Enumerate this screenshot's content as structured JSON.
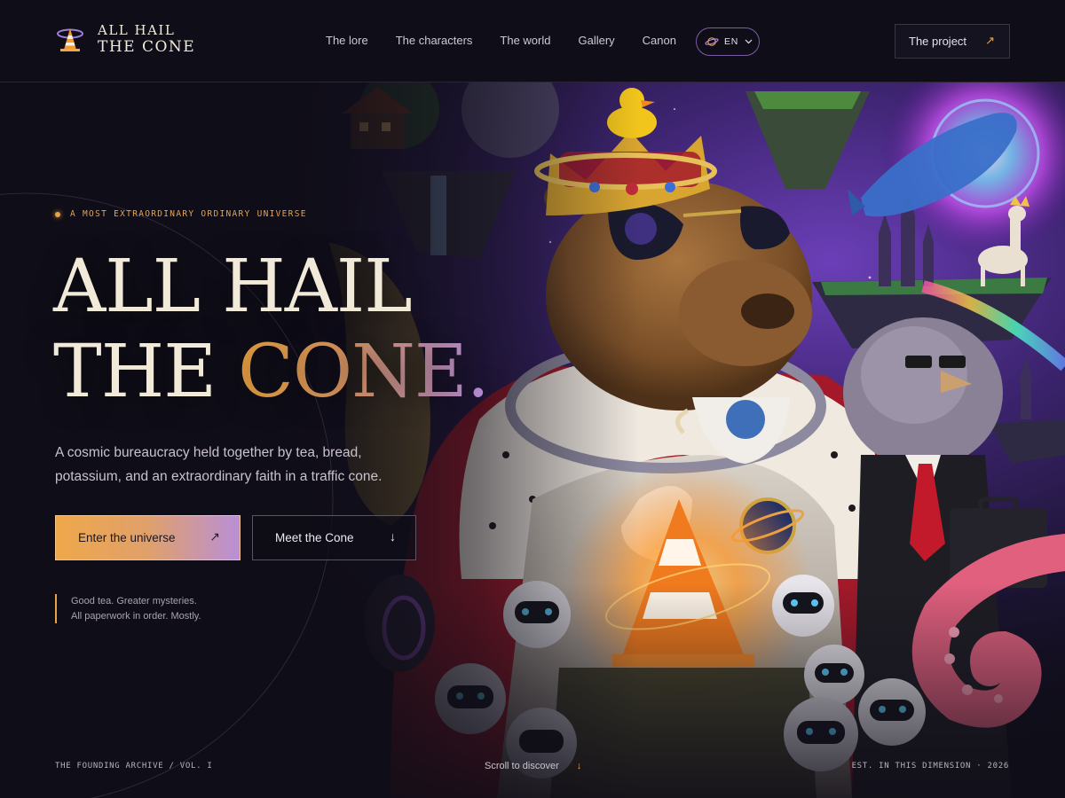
{
  "brand": {
    "line1": "ALL HAIL",
    "line2": "THE CONE"
  },
  "nav": {
    "items": [
      {
        "label": "The lore"
      },
      {
        "label": "The characters"
      },
      {
        "label": "The world"
      },
      {
        "label": "Gallery"
      },
      {
        "label": "Canon"
      }
    ],
    "language": "EN",
    "project_label": "The project",
    "project_icon": "arrow-up-right-icon"
  },
  "hero": {
    "eyebrow": "A MOST EXTRAORDINARY ORDINARY UNIVERSE",
    "headline_line1": "ALL HAIL",
    "headline_line2_plain": "THE ",
    "headline_line2_accent": "CONE.",
    "subtitle": "A cosmic bureaucracy held together by tea, bread, potassium, and an extraordinary faith in a traffic cone.",
    "primary_cta": "Enter the universe",
    "secondary_cta": "Meet the Cone",
    "note_line1": "Good tea. Greater mysteries.",
    "note_line2": "All paperwork in order. Mostly."
  },
  "footer": {
    "left": "THE FOUNDING ARCHIVE / VOL. I",
    "scroll": "Scroll to discover",
    "right": "EST. IN THIS DIMENSION · 2026"
  },
  "colors": {
    "background": "#0f0d17",
    "accent_orange": "#e8a34a",
    "accent_purple": "#b88ee0",
    "text_cream": "#f1ead9"
  }
}
